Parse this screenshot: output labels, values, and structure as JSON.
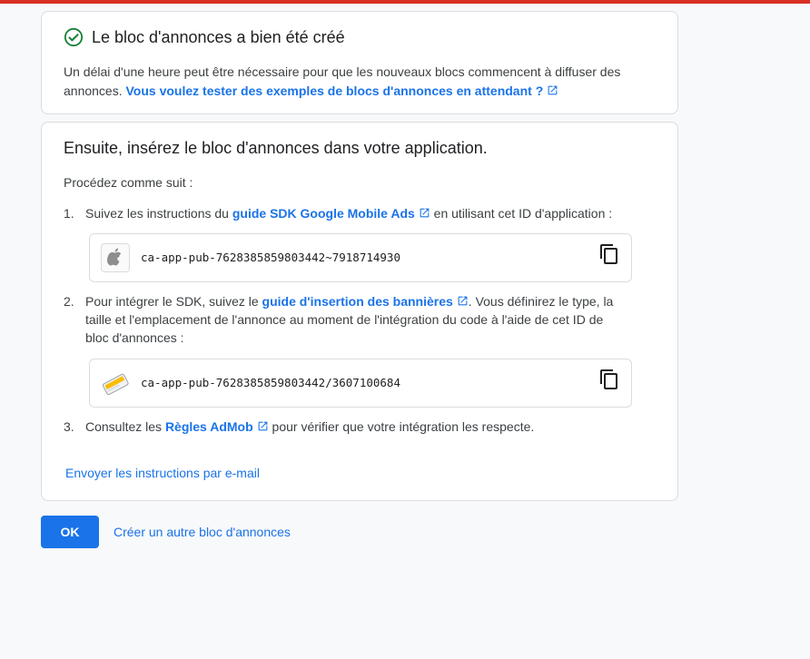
{
  "success_card": {
    "title": "Le bloc d'annonces a bien été créé",
    "note_text": "Un délai d'une heure peut être nécessaire pour que les nouveaux blocs commencent à diffuser des annonces. ",
    "note_link": "Vous voulez tester des exemples de blocs d'annonces en attendant ?"
  },
  "instructions_card": {
    "title": "Ensuite, insérez le bloc d'annonces dans votre application.",
    "intro": "Procédez comme suit :",
    "step1": {
      "num": "1.",
      "before": "Suivez les instructions du ",
      "link": "guide SDK Google Mobile Ads",
      "after": " en utilisant cet ID d'application :",
      "id_value": "ca-app-pub-7628385859803442~7918714930",
      "icon": "apple-icon"
    },
    "step2": {
      "num": "2.",
      "before": "Pour intégrer le SDK, suivez le ",
      "link": "guide d'insertion des bannières",
      "after": ". Vous définirez le type, la taille et l'emplacement de l'annonce au moment de l'intégration du code à l'aide de cet ID de bloc d'annonces :",
      "id_value": "ca-app-pub-7628385859803442/3607100684",
      "icon": "banner-ad-icon"
    },
    "step3": {
      "num": "3.",
      "before": "Consultez les ",
      "link": "Règles AdMob",
      "after": " pour vérifier que votre intégration les respecte."
    },
    "email_link": "Envoyer les instructions par e-mail"
  },
  "actions": {
    "ok_label": "OK",
    "create_another_label": "Créer un autre bloc d'annonces"
  },
  "colors": {
    "accent": "#1a73e8",
    "success": "#188038",
    "top_bar": "#d93025"
  }
}
